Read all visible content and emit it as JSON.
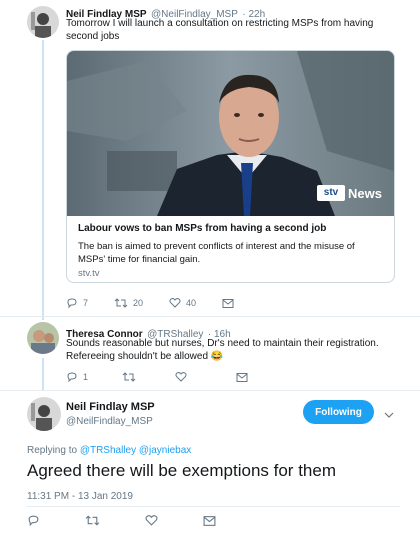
{
  "tweet1": {
    "name": "Neil Findlay MSP",
    "handle": "@NeilFindlay_MSP",
    "time": "· 22h",
    "text": "Tomorrow I will launch a consultation on restricting MSPs from having second jobs",
    "card": {
      "logo_text": "News",
      "title": "Labour vows to ban MSPs from having a second job",
      "description": "The ban is aimed to prevent conflicts of interest and the misuse of MSPs' time for financial gain.",
      "host": "stv.tv"
    },
    "actions": {
      "replies": "7",
      "retweets": "20",
      "likes": "40"
    }
  },
  "tweet2": {
    "name": "Theresa Connor",
    "handle": "@TRShalley",
    "time": "· 16h",
    "text": "Sounds reasonable but nurses, Dr's need to  maintain their registration. Refereeing shouldn't be allowed",
    "emoji": "😂",
    "actions": {
      "replies": "1",
      "retweets": "",
      "likes": ""
    }
  },
  "main_tweet": {
    "name": "Neil Findlay MSP",
    "handle": "@NeilFindlay_MSP",
    "follow_label": "Following",
    "replying_prefix": "Replying to",
    "replying_to_1": "@TRShalley",
    "replying_to_2": "@jayniebax",
    "text": "Agreed there will be exemptions for them",
    "timestamp": "11:31 PM - 13 Jan 2019"
  },
  "icons": [
    "reply-icon",
    "retweet-icon",
    "like-icon",
    "dm-icon",
    "chevron-down-icon"
  ],
  "colors": {
    "accent": "#1da1f2",
    "thread_line": "#cce2f5",
    "muted": "#657786"
  }
}
